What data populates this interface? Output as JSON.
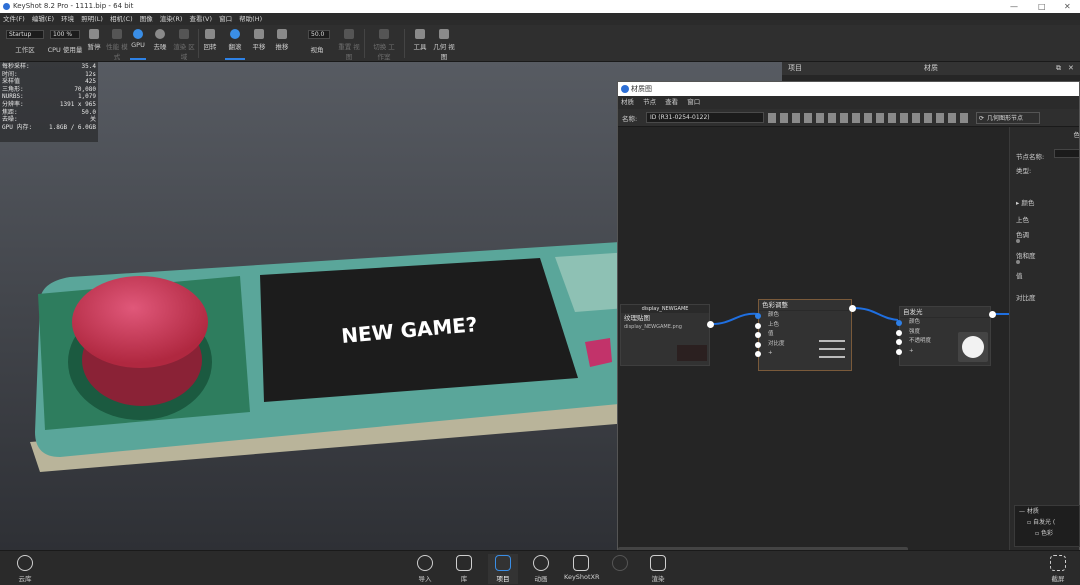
{
  "window": {
    "title": "KeyShot 8.2 Pro  - 1111.bip  - 64 bit"
  },
  "menu": [
    "文件(F)",
    "编辑(E)",
    "环境",
    "照明(L)",
    "相机(C)",
    "图像",
    "渲染(R)",
    "查看(V)",
    "窗口",
    "帮助(H)"
  ],
  "toolbar": {
    "workspace_value": "Startup",
    "workspace_label": "工作区",
    "cpu_value": "100 %",
    "cpu_label": "CPU 使用量",
    "pause_label": "暂停",
    "performance_label": "性能\n模式",
    "gpu_label": "GPU",
    "denoise_label": "去噪",
    "region_label": "渲染\n区域",
    "turntable_label": "回转",
    "tumble_label": "翻滚",
    "pan_label": "平移",
    "dolly_label": "推移",
    "fov_value": "50.0",
    "fov_label": "视角",
    "reset_label": "重置\n视图",
    "switch_label": "切换\n工作室",
    "tools_label": "工具",
    "geometry_label": "几何\n视图"
  },
  "stats": [
    {
      "k": "每秒采样:",
      "v": "35.4"
    },
    {
      "k": "时间:",
      "v": "12s"
    },
    {
      "k": "采样值",
      "v": "425"
    },
    {
      "k": "三角形:",
      "v": "70,080"
    },
    {
      "k": "NURBS:",
      "v": "1,079"
    },
    {
      "k": "分辨率:",
      "v": "1391 x 965"
    },
    {
      "k": "焦距:",
      "v": "50.0"
    },
    {
      "k": "去噪:",
      "v": "关"
    },
    {
      "k": "GPU 内存:",
      "v": "1.8GB / 6.0GB"
    }
  ],
  "scene": {
    "screen_text": "NEW GAME?"
  },
  "project_panel": {
    "tab1": "项目",
    "tab2": "材质"
  },
  "material_graph": {
    "title": "材质图",
    "menu": [
      "材质",
      "节点",
      "查看",
      "窗口"
    ],
    "name_label": "名称:",
    "name_value": "ID (R31-0254-0122)",
    "geometry_node_button": "几何图形节点",
    "nodes": {
      "texture": {
        "header": "display_NEWGAME",
        "title": "纹理贴图",
        "file": "display_NEWGAME.png"
      },
      "color_adjust": {
        "title": "色彩调整",
        "ports": [
          "颜色",
          "上色",
          "值",
          "对比度",
          "+"
        ]
      },
      "emissive": {
        "title": "自发光",
        "ports": [
          "颜色",
          "强度",
          "不透明度",
          "+"
        ]
      }
    },
    "props": {
      "header": "色",
      "node_name_label": "节点名称:",
      "type_label": "类型:",
      "color_section": "颜色",
      "tint_label": "上色",
      "hue_label": "色调",
      "saturation_label": "饱和度",
      "value_label": "值",
      "contrast_label": "对比度"
    },
    "tree": {
      "root": "材质",
      "child1": "自发光 (",
      "child2": "色彩"
    }
  },
  "bottombar": {
    "cloud_label": "云库",
    "import_label": "导入",
    "library_label": "库",
    "project_label": "项目",
    "animation_label": "动画",
    "xr_label": "KeyShotXR",
    "render_label": "渲染",
    "screenshot_label": "截屏"
  },
  "colors": {
    "accent": "#2e82e6",
    "device_body": "#5aa69a",
    "button": "#d23a55",
    "wire": "#1f6fe0"
  }
}
